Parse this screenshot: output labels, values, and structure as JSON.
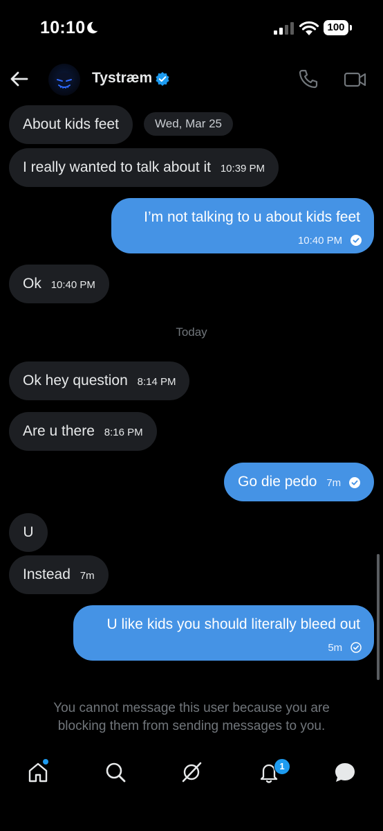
{
  "status_bar": {
    "time": "10:10",
    "battery": "100"
  },
  "header": {
    "name": "Tystræm"
  },
  "messages": [
    {
      "text": "About kids feet",
      "direction": "in"
    },
    {
      "text": "I really wanted to talk about it",
      "time": "10:39 PM",
      "direction": "in"
    },
    {
      "text": "I’m not talking to u about kids feet",
      "time": "10:40 PM",
      "direction": "out",
      "read": true
    },
    {
      "text": "Ok",
      "time": "10:40 PM",
      "direction": "in"
    },
    {
      "text": "Ok hey question",
      "time": "8:14 PM",
      "direction": "in"
    },
    {
      "text": "Are u there",
      "time": "8:16 PM",
      "direction": "in"
    },
    {
      "text": "Go die pedo",
      "time": "7m",
      "direction": "out",
      "read": true
    },
    {
      "text": "U",
      "direction": "in"
    },
    {
      "text": "Instead",
      "time": "7m",
      "direction": "in"
    },
    {
      "text": "U like kids you should literally bleed out",
      "time": "5m",
      "direction": "out",
      "read": false
    }
  ],
  "date_chip": "Wed, Mar 25",
  "day_separator": "Today",
  "blocked_notice": "You cannot message this user because you are blocking them from sending messages to you.",
  "tab_bar": {
    "items": [
      "home-icon",
      "search-icon",
      "grok-icon",
      "notifications-icon",
      "messages-icon"
    ],
    "notifications_badge": "1"
  },
  "colors": {
    "accent": "#1d9bf0",
    "outgoing_bubble": "#4593e5",
    "incoming_bubble": "#1d1f23"
  }
}
